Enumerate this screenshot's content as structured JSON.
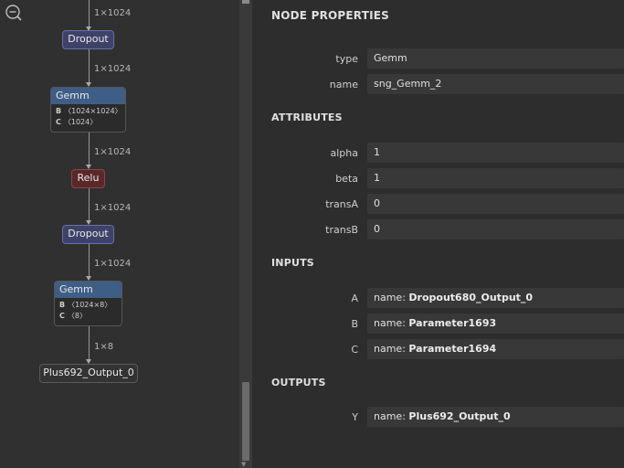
{
  "graph": {
    "zoom_icon": "zoom-out-icon",
    "edge_labels": [
      "1×1024",
      "1×1024",
      "1×1024",
      "1×1024",
      "1×1024",
      "1×8"
    ],
    "nodes": {
      "dropout1": "Dropout",
      "gemm1": {
        "title": "Gemm",
        "attrs": [
          {
            "key": "B",
            "value": "〈1024×1024〉"
          },
          {
            "key": "C",
            "value": "〈1024〉"
          }
        ]
      },
      "relu": "Relu",
      "dropout2": "Dropout",
      "gemm2": {
        "title": "Gemm",
        "attrs": [
          {
            "key": "B",
            "value": "〈1024×8〉"
          },
          {
            "key": "C",
            "value": "〈8〉"
          }
        ]
      },
      "output": "Plus692_Output_0"
    }
  },
  "panel": {
    "title": "NODE PROPERTIES",
    "properties": [
      {
        "label": "type",
        "value": "Gemm"
      },
      {
        "label": "name",
        "value": "sng_Gemm_2"
      }
    ],
    "attributes_title": "ATTRIBUTES",
    "attributes": [
      {
        "label": "alpha",
        "value": "1"
      },
      {
        "label": "beta",
        "value": "1"
      },
      {
        "label": "transA",
        "value": "0"
      },
      {
        "label": "transB",
        "value": "0"
      }
    ],
    "inputs_title": "INPUTS",
    "inputs": [
      {
        "label": "A",
        "prefix": "name: ",
        "value": "Dropout680_Output_0"
      },
      {
        "label": "B",
        "prefix": "name: ",
        "value": "Parameter1693"
      },
      {
        "label": "C",
        "prefix": "name: ",
        "value": "Parameter1694"
      }
    ],
    "outputs_title": "OUTPUTS",
    "outputs": [
      {
        "label": "Y",
        "prefix": "name: ",
        "value": "Plus692_Output_0"
      }
    ]
  },
  "colors": {
    "background": "#2d2d2d",
    "graph_background": "#303030",
    "dropout_node": "#3f4268",
    "relu_node": "#5a2828",
    "gemm_header": "#3f5e86"
  }
}
